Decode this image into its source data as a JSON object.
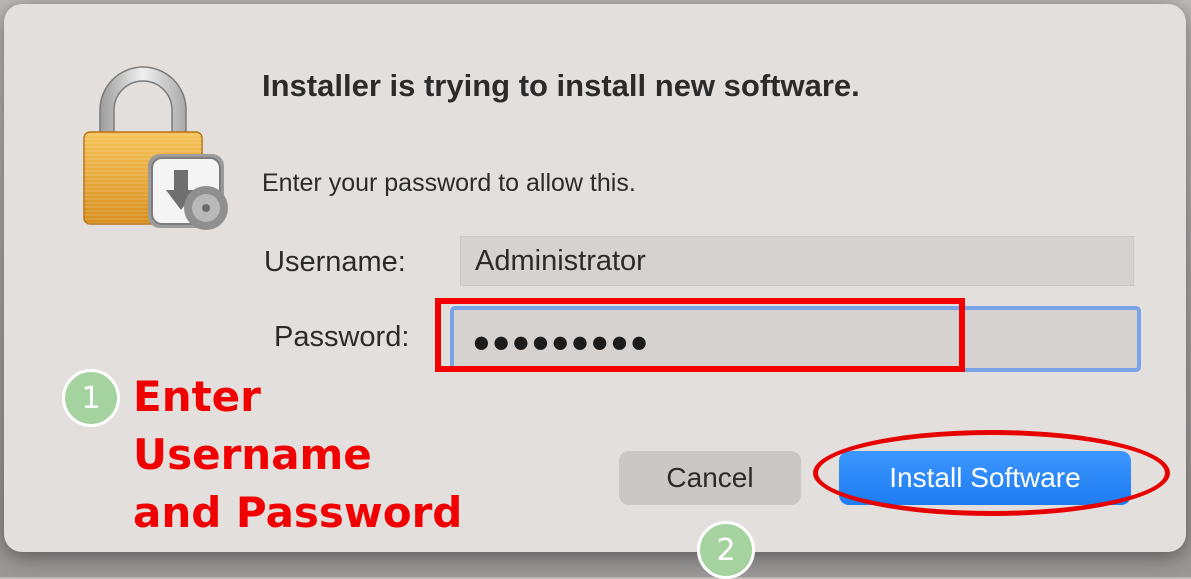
{
  "dialog": {
    "title": "Installer is trying to install new software.",
    "message": "Enter your password to allow this.",
    "username_label": "Username:",
    "username_value": "Administrator",
    "password_label": "Password:",
    "password_value": "●●●●●●●●●",
    "cancel_label": "Cancel",
    "install_label": "Install Software",
    "icon": "lock-with-install-disk-icon"
  },
  "annotations": {
    "step1_number": "1",
    "step1_text": "Enter\nUsername\nand Password",
    "step2_number": "2",
    "highlight_color": "#f00000",
    "badge_color": "#a5d3a0"
  },
  "colors": {
    "accent": "#1e7cf2",
    "focus_ring": "#7aa2e6",
    "dialog_bg": "#e3dfdd"
  }
}
